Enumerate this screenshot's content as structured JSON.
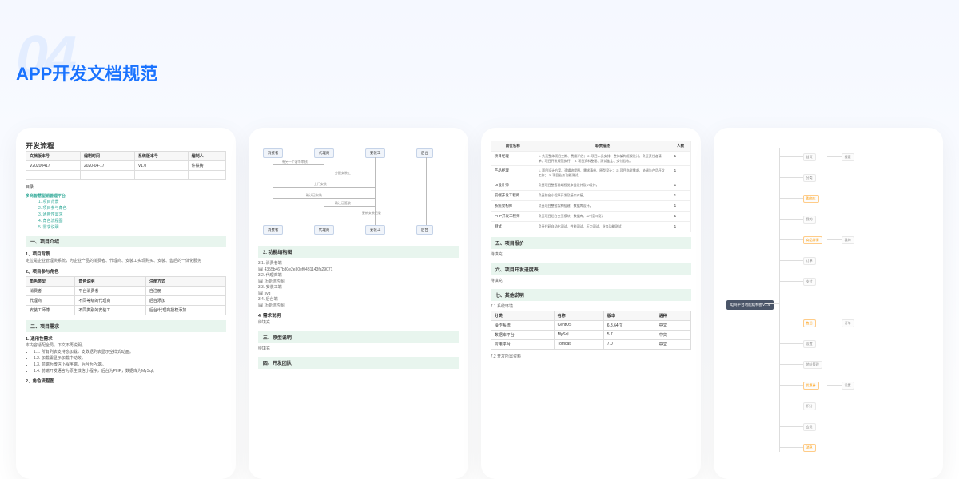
{
  "bgNumber": "04",
  "mainTitle": "APP开发文档规范",
  "doc1": {
    "title": "开发流程",
    "headerRow": [
      "文档版本号",
      "编制时间",
      "系统版本号",
      "编制人"
    ],
    "dataRow": [
      "V20200417",
      "2020-04-17",
      "V1.0",
      "许铁铸"
    ],
    "catalogLabel": "目录",
    "platformTitle": "多商智慧型销管理平台",
    "toc": [
      "1. 项目背景",
      "2. 项目参与角色",
      "3. 通用性需求",
      "4. 角色流程图",
      "5. 需求说明"
    ],
    "sec1": "一、项目介绍",
    "sub11": "1、项目背景",
    "bg": "定位是企业管理类系统，为企业产品的消费者、代理商、安装工实现购买、安装、售后的一体化服务",
    "sub12": "2、项目参与角色",
    "roleHeaders": [
      "角色类型",
      "角色说明",
      "注册方式"
    ],
    "roleRows": [
      [
        "消费者",
        "平台消费者",
        "自注册"
      ],
      [
        "代理商",
        "不同等级的代理商",
        "后台添加"
      ],
      [
        "安装工师傅",
        "不同类别的安装工",
        "后台/代理商授权添加"
      ]
    ],
    "sec2": "二、项目需求",
    "sub21": "1. 通用性需求",
    "reqIntro": "本内容适配全局，下文不再说明。",
    "reqs": [
      "1.1. 所有列表支持态加载，支数据列表显示空样式动画。",
      "1.2. 加载需显示加载中动效。",
      "1.3. 前端为微信小程序端，后台为Pc端。",
      "1.4. 前端开发语言为原生微信小程序，后台为PHP，数据库为MySql。"
    ],
    "sub22": "2、角色流程图"
  },
  "doc2": {
    "flowTop": [
      "消费者",
      "代理商",
      "安装工",
      "后台"
    ],
    "flowBottom": [
      "消费者",
      "代理商",
      "安装工",
      "后台"
    ],
    "labels": {
      "l1": "有另一个客等审核",
      "l2": "分配安装工",
      "l3": "上门安装",
      "l4": "确认已安装",
      "l5": "确认已签收",
      "l6": "更新安装记录"
    },
    "sec3": "3. 功能结构图",
    "sub31": "3.1. 消费者端",
    "refImg": "4355b467b30e2e30ef0431143fa29071",
    "sub32": "3.2. 代理商端",
    "structNote1": "功能结构图",
    "sub33": "3.3. 安装工端",
    "svgNote": "svg",
    "sub34": "3.4. 后台端",
    "structNote2": "功能结构图",
    "sub4": "4. 需求说明",
    "pending1": "待填充",
    "sec4": "三、原型说明",
    "pending2": "待填充",
    "sec5": "四、开发团队"
  },
  "doc3": {
    "tblHeaders": [
      "岗位名称",
      "职责描述",
      "人数"
    ],
    "rows": [
      {
        "role": "项目经理",
        "desc": "1. 负责整体项目工期、费用评估；\n2. 项目人员安排、整体架构框架设计、负责责任者清单、项目开发规范执行；\n3. 项目资料整理、测试鉴定、交付验收。",
        "count": "1"
      },
      {
        "role": "产品经理",
        "desc": "1. 项目设计方案、逻辑流程图、需求清单、原型设计；\n2. 项目临时需求、协调与产品开发工作；\n3. 项目业务功能测试。",
        "count": "1"
      },
      {
        "role": "UI设计师",
        "desc": "负责项目整套前端视觉审美设计及UI设计。",
        "count": "1"
      },
      {
        "role": "前端开发工程师",
        "desc": "负责前台小程序开发及接口对接。",
        "count": "1"
      },
      {
        "role": "系统架构师",
        "desc": "负责项目整套架构搭建、数据库设计。",
        "count": "1"
      },
      {
        "role": "PHP开发工程师",
        "desc": "负责项目后台交互模块、数据库、API接口设计",
        "count": "1"
      },
      {
        "role": "测试",
        "desc": "负责代码自动化测试、性能测试、压力测试、业务功能测试",
        "count": "1"
      }
    ],
    "sec5": "五、项目报价",
    "pending1": "待填充",
    "sec6": "六、项目开发进度表",
    "pending2": "待填充",
    "sec7": "七、其他说明",
    "sub71": "7.1 系统环境",
    "envHeaders": [
      "分类",
      "名称",
      "版本",
      "语种"
    ],
    "envRows": [
      [
        "操作系统",
        "CentOS",
        "6.8.64位",
        "中文"
      ],
      [
        "数据库平台",
        "MySql",
        "5.7",
        "中文"
      ],
      [
        "应用平台",
        "Tomcat",
        "7.0",
        "中文"
      ]
    ],
    "sub72": "7.2 开发所需资料"
  },
  "doc4": {
    "root": "电商平台功能结构图V1.4",
    "branches": [
      "首页",
      "分类",
      "购物车",
      "我的",
      "商品详情",
      "订单",
      "支付",
      "售后",
      "设置",
      "地址管理",
      "优惠券",
      "积分",
      "会员",
      "消息",
      "搜索"
    ]
  }
}
